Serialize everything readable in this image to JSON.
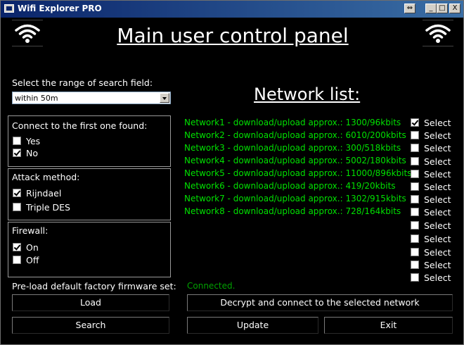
{
  "window": {
    "title": "Wifi Explorer PRO"
  },
  "header": {
    "title": "Main user control panel"
  },
  "range": {
    "label": "Select the range of search field:",
    "selected": "within 50m"
  },
  "connect_first": {
    "title": "Connect to the first one found:",
    "options": [
      {
        "label": "Yes",
        "checked": false
      },
      {
        "label": "No",
        "checked": true
      }
    ]
  },
  "attack": {
    "title": "Attack method:",
    "options": [
      {
        "label": "Rijndael",
        "checked": true
      },
      {
        "label": "Triple DES",
        "checked": false
      }
    ]
  },
  "firewall": {
    "title": "Firewall:",
    "options": [
      {
        "label": "On",
        "checked": true
      },
      {
        "label": "Off",
        "checked": false
      }
    ]
  },
  "firmware": {
    "label": "Pre-load default factory firmware set:"
  },
  "network_list": {
    "title": "Network list:",
    "networks": [
      "Network1 - download/upload approx.: 1300/96kbits",
      "Network2 - download/upload approx.: 6010/200kbits",
      "Network3 - download/upload approx.: 300/518kbits",
      "Network4 - download/upload approx.: 5002/180kbits",
      "Network5 - download/upload approx.: 11000/896kbits",
      "Network6 - download/upload approx.: 419/20kbits",
      "Network7 - download/upload approx.: 1302/915kbits",
      "Network8 - download/upload approx.: 728/164kbits"
    ],
    "select_label": "Select",
    "selected": [
      true,
      false,
      false,
      false,
      false,
      false,
      false,
      false,
      false,
      false,
      false,
      false,
      false
    ]
  },
  "status": "Connected.",
  "buttons": {
    "load": "Load",
    "search": "Search",
    "decrypt": "Decrypt and connect to the selected network",
    "update": "Update",
    "exit": "Exit"
  },
  "title_buttons": {
    "restore": "⇔",
    "minimize": "_",
    "maximize": "□",
    "close": "X"
  },
  "icons": {
    "app": "app-icon",
    "wifi": "wifi-icon"
  },
  "colors": {
    "background": "#000000",
    "network_text": "#00e000",
    "status_text": "#00a000",
    "titlebar": "#0a246a"
  }
}
